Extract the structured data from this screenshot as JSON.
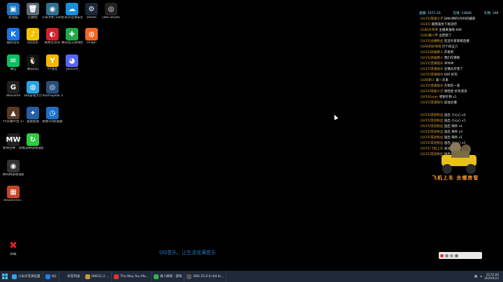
{
  "desktop_icons": [
    {
      "label": "此电脑",
      "color": "#1a78c2",
      "glyph": "▣",
      "name": "this-pc-icon"
    },
    {
      "label": "回收站",
      "color": "#5b6b7a",
      "glyph": "🗑",
      "name": "recycle-bin-icon"
    },
    {
      "label": "小米手机 SamplesM...",
      "color": "#2d6f8f",
      "glyph": "◉",
      "name": "phone-app-icon"
    },
    {
      "label": "小米声音源安装",
      "color": "#1a8fd8",
      "glyph": "☁",
      "name": "cloud-app-icon"
    },
    {
      "label": "Steam",
      "color": "#1b2838",
      "glyph": "⚙",
      "name": "steam-icon"
    },
    {
      "label": "OBS Studio",
      "color": "#222",
      "glyph": "◎",
      "name": "obs-icon"
    },
    {
      "label": "酷狗音乐",
      "color": "#1677e5",
      "glyph": "K",
      "name": "kugou-icon"
    },
    {
      "label": "QQ音乐",
      "color": "#f2c200",
      "glyph": "♪",
      "name": "qq-music-icon"
    },
    {
      "label": "网易云音乐",
      "color": "#d4212b",
      "glyph": "◐",
      "name": "netease-music-icon"
    },
    {
      "label": "腾讯官方游戏加速",
      "color": "#1fa84a",
      "glyph": "✚",
      "name": "game-booster-icon"
    },
    {
      "label": "Origin",
      "color": "#f26522",
      "glyph": "◍",
      "name": "origin-icon"
    },
    {
      "label": "微信",
      "color": "#07c160",
      "glyph": "✉",
      "name": "wechat-icon"
    },
    {
      "label": "腾讯QQ",
      "color": "#111",
      "glyph": "🐧",
      "name": "qq-icon"
    },
    {
      "label": "YY语音",
      "color": "#f5b800",
      "glyph": "Y",
      "name": "yy-icon"
    },
    {
      "label": "Discord",
      "color": "#5865f2",
      "glyph": "◕",
      "name": "discord-icon"
    },
    {
      "label": "WeGame",
      "color": "#222",
      "glyph": "G",
      "name": "wegame-icon"
    },
    {
      "label": "360游戏大厅",
      "color": "#29a3e6",
      "glyph": "◍",
      "name": "game-hall-icon"
    },
    {
      "label": "TeamSpeak 3",
      "color": "#274e7a",
      "glyph": "◎",
      "name": "teamspeak-icon"
    },
    {
      "label": "YY开播平台 2.0",
      "color": "#5a3a22",
      "glyph": "▲",
      "name": "stream-platform-icon"
    },
    {
      "label": "雷霆加速",
      "color": "#245fa8",
      "glyph": "✦",
      "name": "accelerator-icon"
    },
    {
      "label": "网易UU加速器",
      "color": "#1e6fc7",
      "glyph": "◷",
      "name": "uu-icon"
    },
    {
      "label": "使命召唤：现代战争",
      "color": "#222",
      "glyph": "MW",
      "name": "cod-icon"
    },
    {
      "label": "迅游网游加速器",
      "color": "#2ecc40",
      "glyph": "↻",
      "name": "xunyou-icon"
    },
    {
      "label": "腾讯网游加速器",
      "color": "#333",
      "glyph": "◉",
      "name": "tencent-booster-icon"
    },
    {
      "label": "steamcmd...",
      "color": "#c9432a",
      "glyph": "▦",
      "name": "archive-icon"
    },
    {
      "label": "卸载",
      "color": "#000",
      "glyph": "✖",
      "name": "uninstall-icon"
    }
  ],
  "danmaku": {
    "header": [
      "直播: 1071 03",
      "在线: 14846",
      "礼物: 168"
    ],
    "lines": [
      {
        "u": "[LV15]等级小子",
        "t": "DMH神的VS99的最新"
      },
      {
        "u": "[LV15]",
        "t": "跟我来抢下奇迹吧"
      },
      {
        "u": "[LV8]大哥哥",
        "t": "主播真强啊 666"
      },
      {
        "u": "[LV6]路人甲",
        "t": "这把稳了"
      },
      {
        "u": "[LV15]主播粉丝",
        "t": "欢迎大家来看直播"
      },
      {
        "u": "[LV9]的好哥哥",
        "t": "打个四五六"
      },
      {
        "u": "[LV15]高级路人",
        "t": "开麦吧"
      },
      {
        "u": "[LV15]高级路人",
        "t": "我们在哪呢"
      },
      {
        "u": "[LV15]普通观众",
        "t": "冲冲冲"
      },
      {
        "u": "[LV15]普通观众",
        "t": "主播太厉害了"
      },
      {
        "u": "[LV15]普通观众",
        "t": "666 好玩"
      },
      {
        "u": "[LV8]新人",
        "t": "第一次来"
      },
      {
        "u": "[LV15]普通观众",
        "t": "礼物走一波"
      },
      {
        "u": "[LV15]等级小子",
        "t": "哈哈哈 好有意思"
      },
      {
        "u": "[LV10]vyan",
        "t": "感谢礼物 x1"
      },
      {
        "u": "[LV15]普通观众",
        "t": "加油主播"
      },
      {
        "u": "[LV15]常驻粉丝",
        "t": "送出 小心心 x2"
      },
      {
        "u": "[LV15]常驻粉丝",
        "t": "送出 小心心 x1"
      },
      {
        "u": "[LV15]常驻粉丝",
        "t": "送出 辣条 x1"
      },
      {
        "u": "[LV15]常驻粉丝",
        "t": "送出 辣条 x3"
      },
      {
        "u": "[LV15]常驻粉丝",
        "t": "送出 辣条 x1"
      },
      {
        "u": "[LV15]常驻粉丝",
        "t": "送出 小心心 x1"
      },
      {
        "u": "[LV15]飞机上车",
        "t": "关注了主播"
      },
      {
        "u": "[LV15]常驻粉丝",
        "t": "送出 小心心 x1"
      }
    ]
  },
  "mascot_caption": "飞机上车 去哪房管",
  "music_text": "QQ音乐，让生活充满音乐",
  "taskbar": {
    "items": [
      {
        "label": "小米声音源设置",
        "color": "#3aa0e8",
        "name": "taskbar-sound-settings"
      },
      {
        "label": "QQ",
        "color": "#2c7be5",
        "name": "taskbar-qq"
      },
      {
        "label": "好友列表",
        "color": "#1b2838",
        "name": "taskbar-friends"
      },
      {
        "label": "ONE21.2 ...",
        "color": "#c59a3b",
        "name": "taskbar-one21"
      },
      {
        "label": "The Way You Mo...",
        "color": "#e03131",
        "name": "taskbar-music"
      },
      {
        "label": "真人麻将 - 游戏",
        "color": "#2db34a",
        "name": "taskbar-game"
      },
      {
        "label": "OBS 25.0.8 (64 bi...",
        "color": "#555",
        "name": "taskbar-obs"
      }
    ],
    "time": "22:52:00",
    "date": "2020/4/22"
  }
}
